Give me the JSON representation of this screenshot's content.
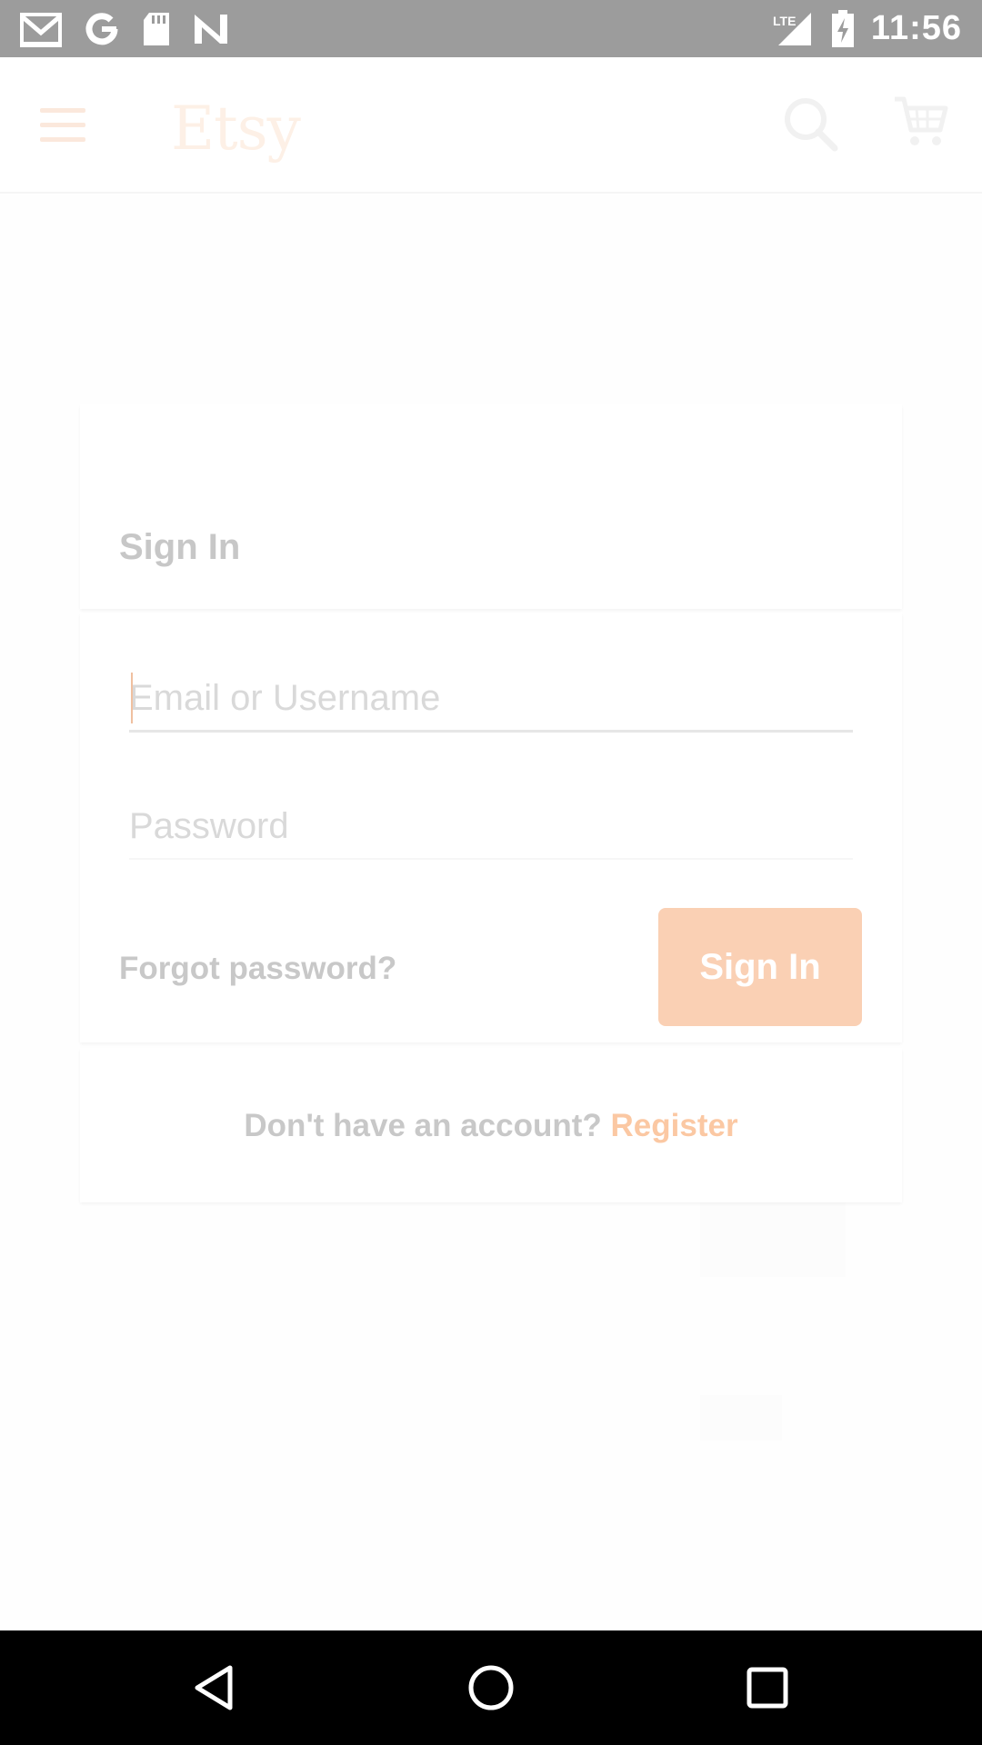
{
  "status_bar": {
    "time": "11:56",
    "network": "LTE",
    "notification_icons": [
      "gmail-icon",
      "google-icon",
      "sd-card-icon",
      "n-icon"
    ],
    "status_icons": [
      "lte-signal-icon",
      "battery-charging-icon"
    ]
  },
  "app_bar": {
    "logo": "Etsy",
    "menu_icon": "hamburger-icon",
    "search_icon": "search-icon",
    "cart_icon": "cart-icon"
  },
  "sign_in": {
    "title": "Sign In",
    "email_placeholder": "Email or Username",
    "password_placeholder": "Password",
    "forgot_password": "Forgot password?",
    "button_label": "Sign In",
    "no_account_text": "Don't have an account?",
    "register_link": "Register"
  },
  "nav_bar": {
    "icons": [
      "back-icon",
      "home-icon",
      "recents-icon"
    ]
  },
  "colors": {
    "status_bar": "#9c9c9c",
    "accent": "#fad0b4",
    "register_link": "#fbc8a3",
    "nav_bar": "#000000"
  }
}
